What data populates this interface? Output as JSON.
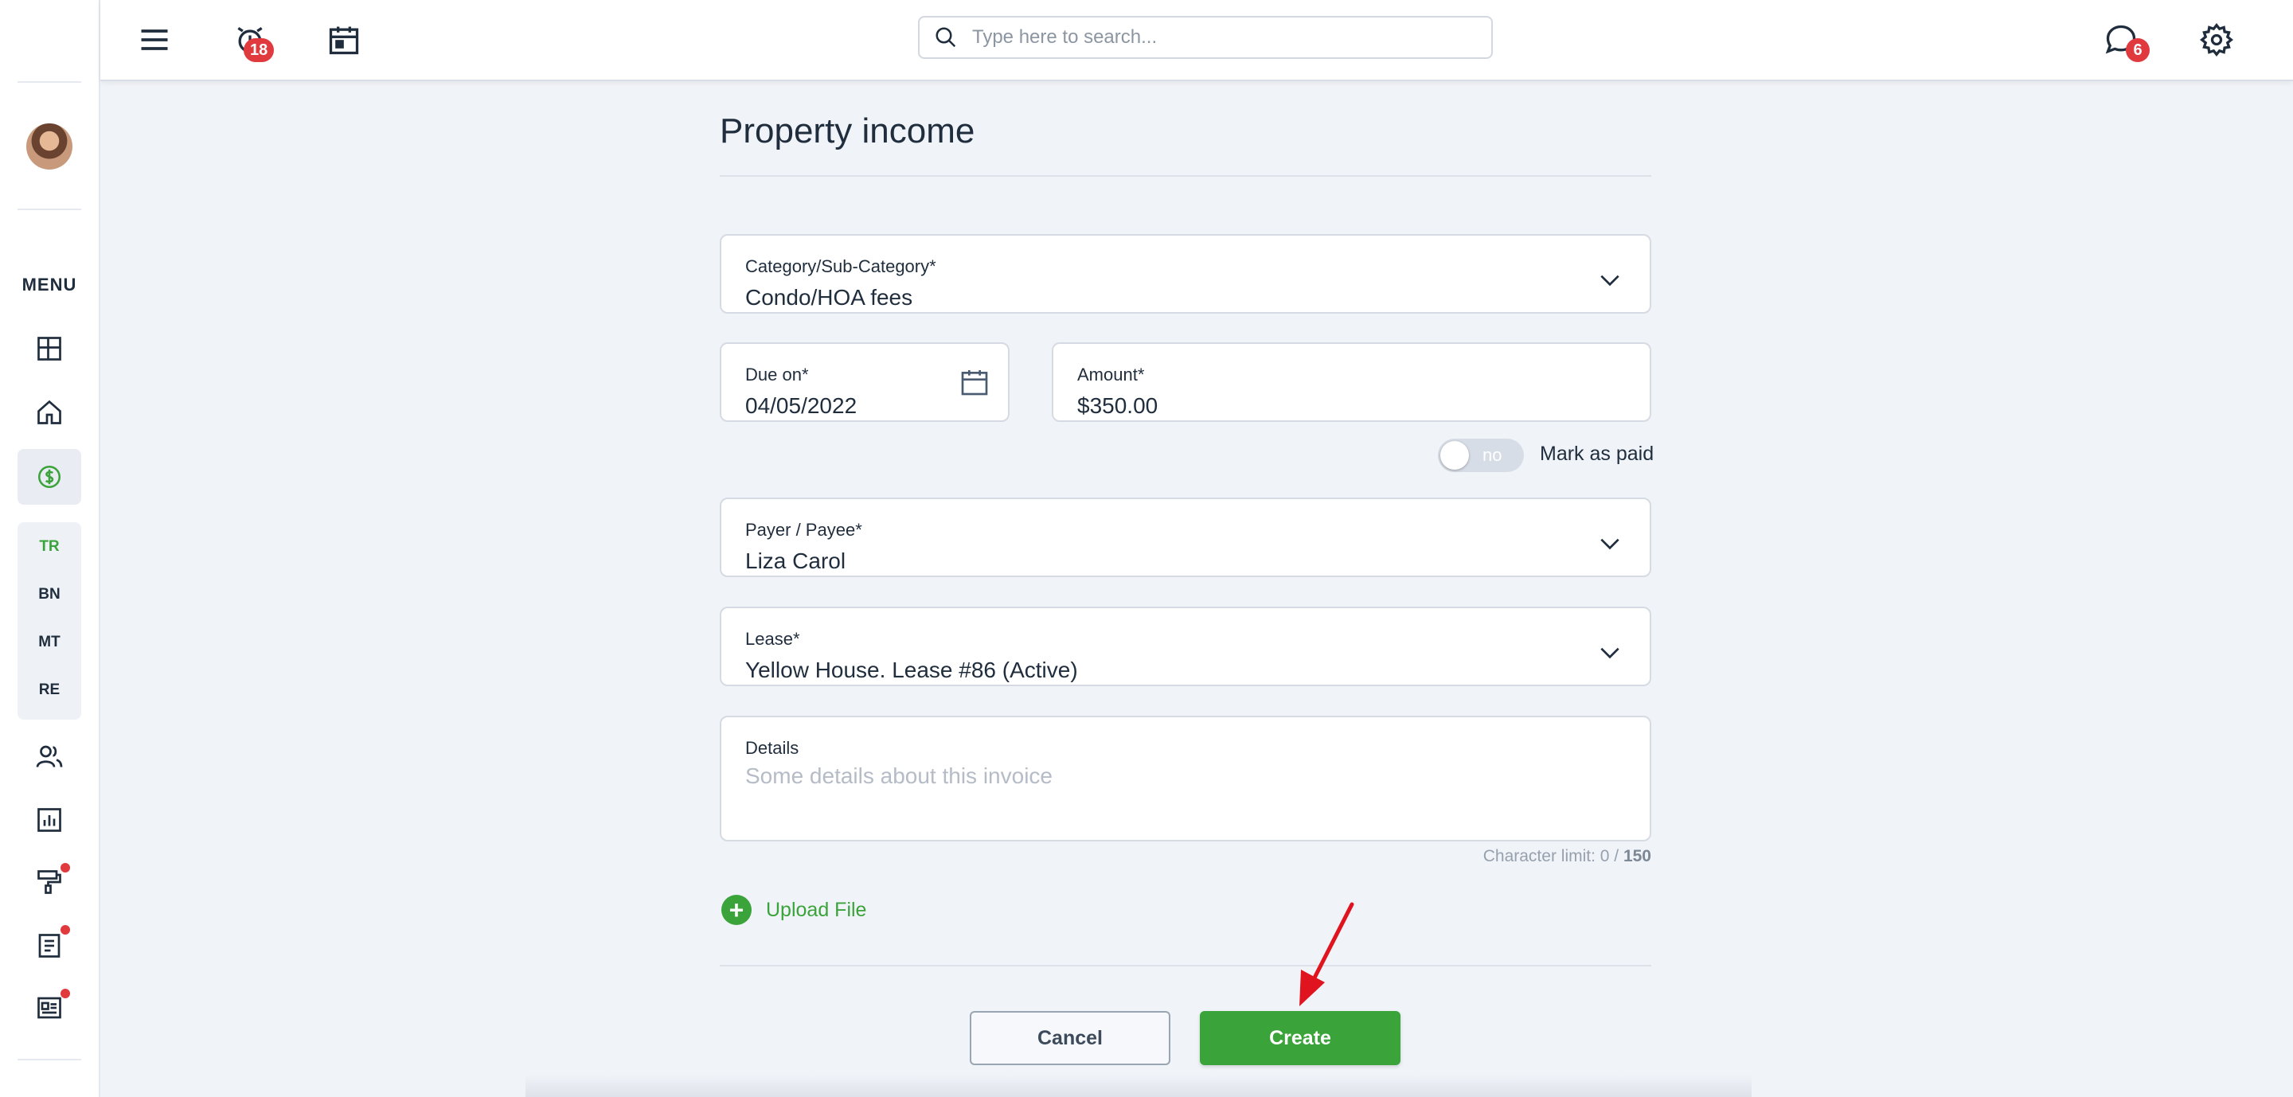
{
  "sidebar": {
    "menu_label": "MENU",
    "sub_items": [
      "TR",
      "BN",
      "MT",
      "RE"
    ],
    "icons": [
      "dashboard-icon",
      "home-icon",
      "dollar-icon",
      "users-icon",
      "chart-icon",
      "paint-roller-icon",
      "document-icon",
      "news-icon"
    ]
  },
  "topbar": {
    "notifications_count": "18",
    "messages_count": "6",
    "search_placeholder": "Type here to search..."
  },
  "form": {
    "title": "Property income",
    "category": {
      "label": "Category/Sub-Category*",
      "value": "Condo/HOA fees"
    },
    "due_on": {
      "label": "Due on*",
      "value": "04/05/2022"
    },
    "amount": {
      "label": "Amount*",
      "value": "$350.00"
    },
    "mark_as_paid": {
      "toggle_text": "no",
      "label": "Mark as paid"
    },
    "payer": {
      "label": "Payer / Payee*",
      "value": "Liza Carol"
    },
    "lease": {
      "label": "Lease*",
      "value": "Yellow House. Lease #86 (Active)"
    },
    "details": {
      "label": "Details",
      "placeholder": "Some details about this invoice"
    },
    "char_limit": {
      "prefix": "Character limit: 0 / ",
      "max": "150"
    },
    "upload_label": "Upload File",
    "cancel_label": "Cancel",
    "create_label": "Create"
  },
  "colors": {
    "accent_green": "#3aa33a",
    "badge_red": "#e0393e",
    "text_dark": "#1f2d3d",
    "background": "#f0f3f8"
  }
}
